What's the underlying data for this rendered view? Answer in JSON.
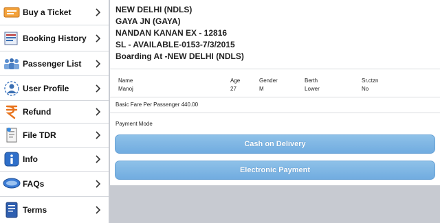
{
  "sidebar": {
    "items": [
      {
        "label": "Buy a Ticket",
        "icon": "ticket-icon"
      },
      {
        "label": "Booking History",
        "icon": "booking-history-icon"
      },
      {
        "label": "Passenger List",
        "icon": "passenger-list-icon"
      },
      {
        "label": "User Profile",
        "icon": "user-profile-icon"
      },
      {
        "label": "Refund",
        "icon": "refund-icon"
      },
      {
        "label": "File TDR",
        "icon": "file-tdr-icon"
      },
      {
        "label": "Info",
        "icon": "info-icon"
      },
      {
        "label": "FAQs",
        "icon": "faqs-icon"
      },
      {
        "label": "Terms",
        "icon": "terms-icon"
      }
    ]
  },
  "journey": {
    "from": "NEW DELHI (NDLS)",
    "to": "GAYA JN (GAYA)",
    "train": "NANDAN KANAN EX - 12816",
    "availability": "SL - AVAILABLE-0153-7/3/2015",
    "boarding": "Boarding At -NEW DELHI (NDLS)"
  },
  "passenger_table": {
    "headers": {
      "name": "Name",
      "age": "Age",
      "gender": "Gender",
      "berth": "Berth",
      "senior": "Sr.ctzn"
    },
    "rows": [
      {
        "name": "Manoj",
        "age": "27",
        "gender": "M",
        "berth": "Lower",
        "senior": "No"
      }
    ]
  },
  "fare": {
    "text": "Basic Fare Per Passenger  440.00"
  },
  "payment": {
    "label": "Payment Mode",
    "cash_label": "Cash on Delivery",
    "electronic_label": "Electronic Payment"
  },
  "colors": {
    "button_blue": "#7ab3e2",
    "sidebar_bg": "#ffffff",
    "page_bg": "#c9ccd3"
  }
}
